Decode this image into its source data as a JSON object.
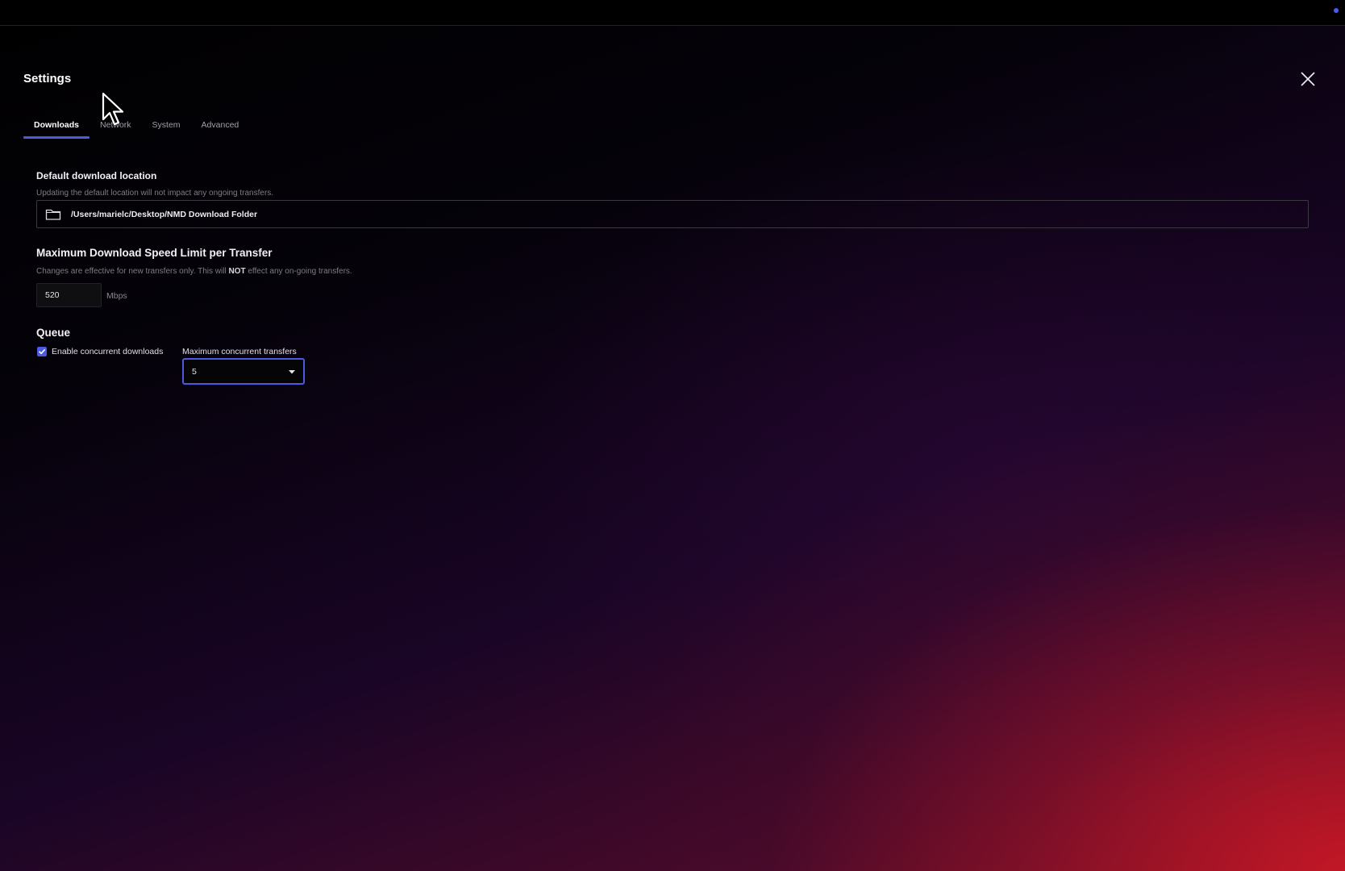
{
  "dialog": {
    "title": "Settings",
    "close_icon": "close-icon"
  },
  "tabs": [
    {
      "label": "Downloads",
      "active": true
    },
    {
      "label": "Network",
      "active": false
    },
    {
      "label": "System",
      "active": false
    },
    {
      "label": "Advanced",
      "active": false
    }
  ],
  "download_location": {
    "title": "Default download location",
    "help": "Updating the default location will not impact any ongoing transfers.",
    "path": "/Users/marielc/Desktop/NMD Download Folder",
    "icon": "folder-icon"
  },
  "speed_limit": {
    "title": "Maximum Download Speed Limit per Transfer",
    "help_before": "Changes are effective for new transfers only. This will ",
    "help_bold": "NOT",
    "help_after": " effect any on-going transfers.",
    "value": "520",
    "unit": "Mbps"
  },
  "queue": {
    "title": "Queue",
    "concurrent_checkbox_label": "Enable concurrent downloads",
    "concurrent_checked": true,
    "max_transfers_label": "Maximum concurrent transfers",
    "max_transfers_value": "5"
  },
  "colors": {
    "accent": "#4b5ae0",
    "background_glow": "#c81826"
  }
}
